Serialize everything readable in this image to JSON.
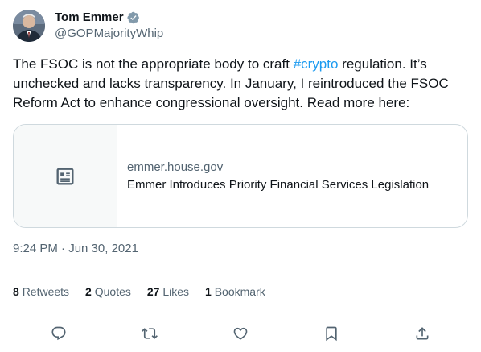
{
  "author": {
    "display_name": "Tom Emmer",
    "handle": "@GOPMajorityWhip",
    "verified": true
  },
  "tweet": {
    "text_before": "The FSOC is not the appropriate body to craft ",
    "hashtag": "#crypto",
    "text_after": " regulation. It’s unchecked and lacks transparency. In January, I reintroduced the FSOC Reform Act to enhance congressional oversight. Read more here:"
  },
  "card": {
    "domain": "emmer.house.gov",
    "title": "Emmer Introduces Priority Financial Services Legislation",
    "icon": "article-icon"
  },
  "timestamp": "9:24 PM · Jun 30, 2021",
  "stats": {
    "retweets_count": "8",
    "retweets_label": "Retweets",
    "quotes_count": "2",
    "quotes_label": "Quotes",
    "likes_count": "27",
    "likes_label": "Likes",
    "bookmarks_count": "1",
    "bookmarks_label": "Bookmark"
  },
  "actions": [
    "reply-icon",
    "retweet-icon",
    "like-icon",
    "bookmark-icon",
    "share-icon"
  ],
  "colors": {
    "link": "#1d9bf0",
    "verified": "#829aab",
    "secondary_text": "#536471",
    "border": "#cfd9de"
  }
}
